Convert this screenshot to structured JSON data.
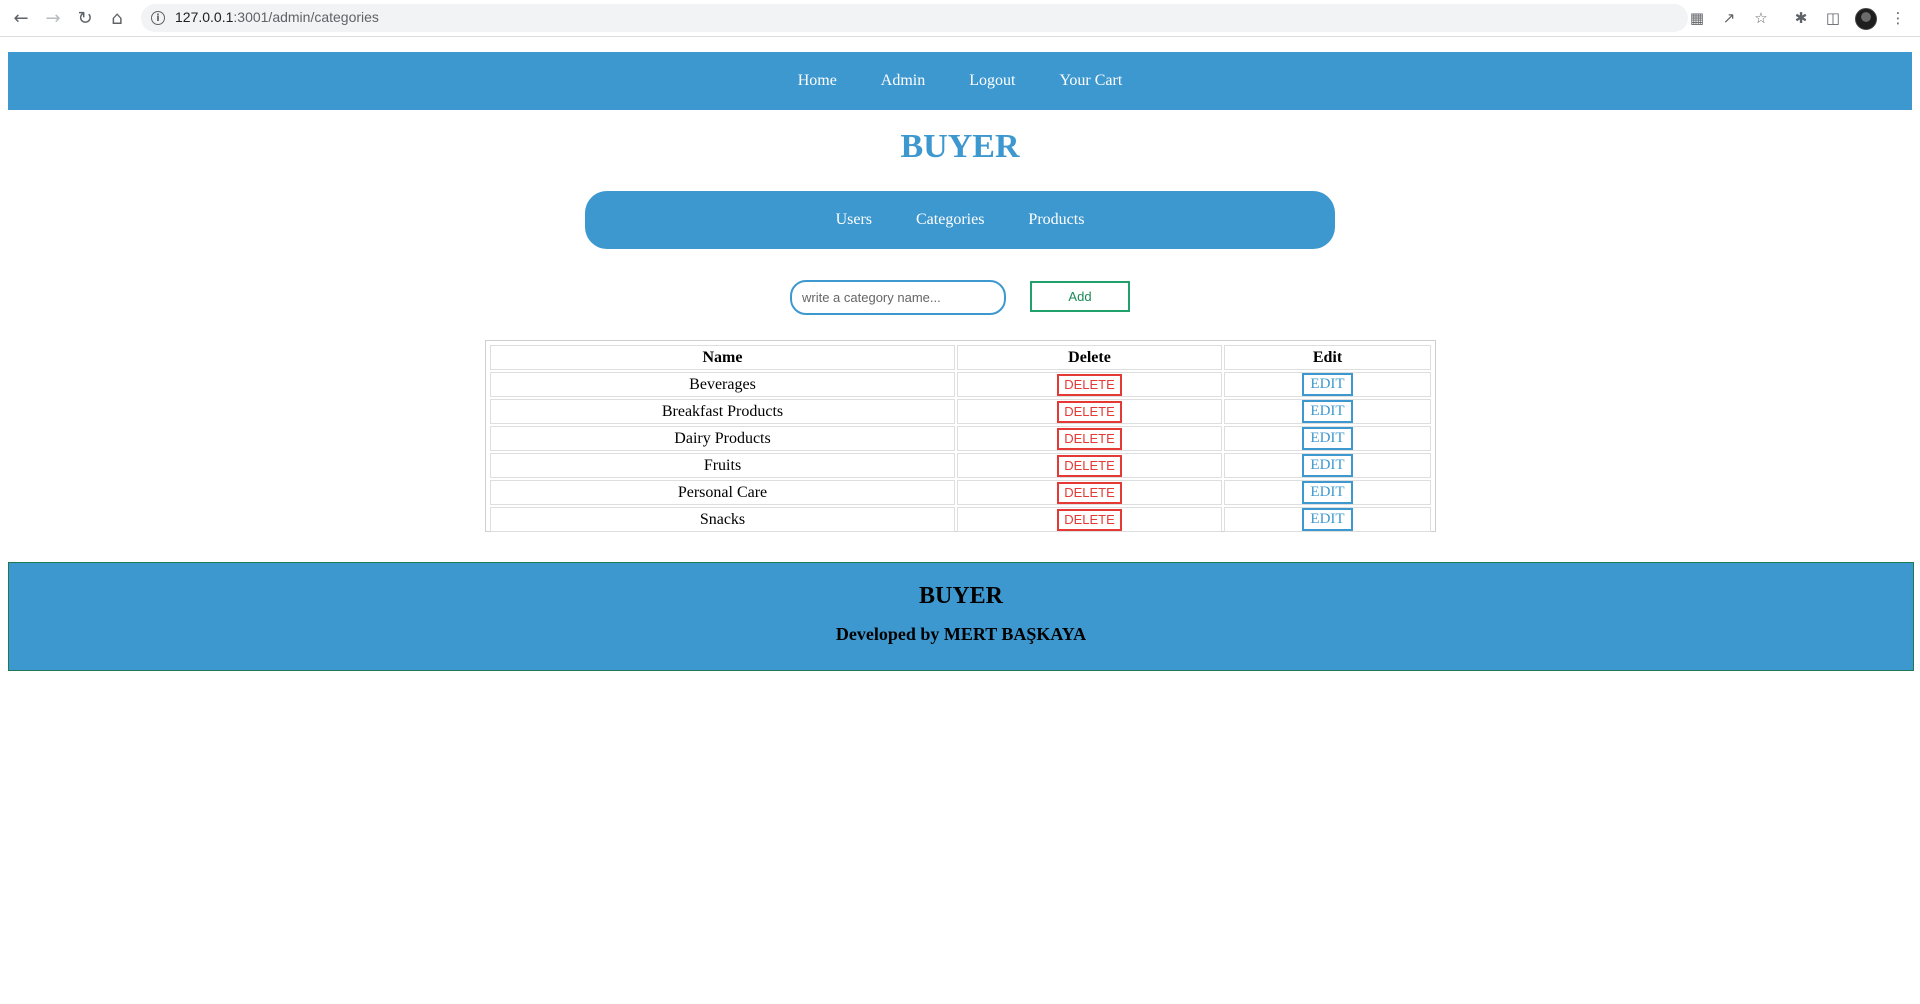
{
  "browser": {
    "url_host": "127.0.0.1",
    "url_path": ":3001/admin/categories"
  },
  "topnav": {
    "items": [
      "Home",
      "Admin",
      "Logout",
      "Your Cart"
    ]
  },
  "brand": "BUYER",
  "adminnav": {
    "items": [
      "Users",
      "Categories",
      "Products"
    ]
  },
  "category_form": {
    "placeholder": "write a category name...",
    "add_label": "Add"
  },
  "table": {
    "headers": [
      "Name",
      "Delete",
      "Edit"
    ],
    "delete_label": "DELETE",
    "edit_label": "EDIT",
    "rows": [
      {
        "name": "Beverages"
      },
      {
        "name": "Breakfast Products"
      },
      {
        "name": "Dairy Products"
      },
      {
        "name": "Fruits"
      },
      {
        "name": "Personal Care"
      },
      {
        "name": "Snacks"
      }
    ]
  },
  "footer": {
    "title": "BUYER",
    "credit": "Developed by MERT BAŞKAYA"
  },
  "colors": {
    "primary": "#3d98cf",
    "delete": "#e53935",
    "add": "#20a06a"
  }
}
